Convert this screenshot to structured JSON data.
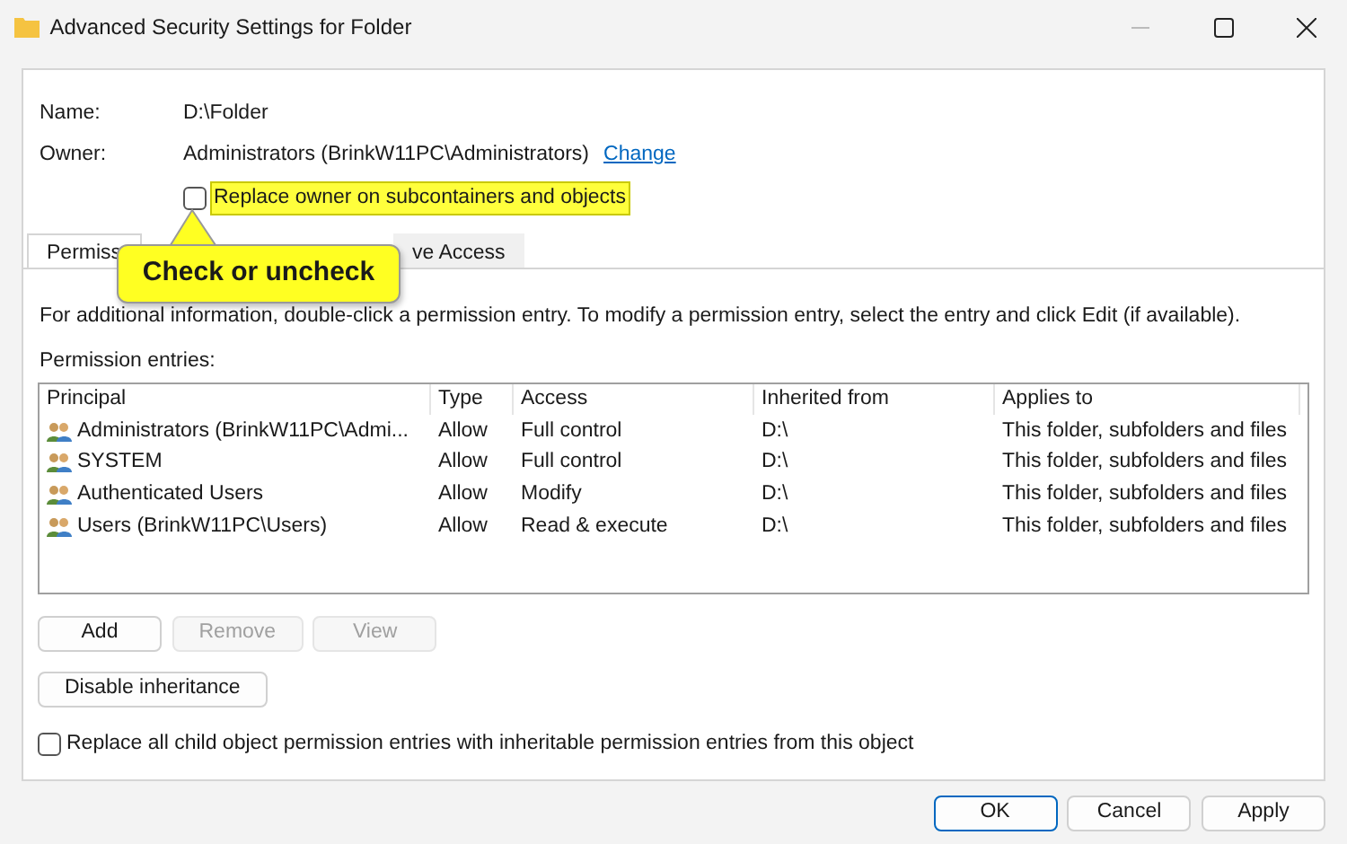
{
  "window": {
    "title": "Advanced Security Settings for Folder"
  },
  "name": {
    "label": "Name:",
    "value": "D:\\Folder"
  },
  "owner": {
    "label": "Owner:",
    "value": "Administrators (BrinkW11PC\\Administrators)",
    "link": "Change"
  },
  "owner_checkbox": {
    "label": "Replace owner on subcontainers and objects",
    "checked": false,
    "highlighted": true
  },
  "callout": {
    "text": "Check or uncheck"
  },
  "tabs": [
    {
      "label": "Permiss",
      "selected": true
    },
    {
      "label": "ve Access",
      "selected": false
    }
  ],
  "info": "For additional information, double-click a permission entry. To modify a permission entry, select the entry and click Edit (if available).",
  "entries_label": "Permission entries:",
  "table": {
    "columns": [
      "Principal",
      "Type",
      "Access",
      "Inherited from",
      "Applies to"
    ],
    "rows": [
      [
        "Administrators (BrinkW11PC\\Admi...",
        "Allow",
        "Full control",
        "D:\\",
        "This folder, subfolders and files"
      ],
      [
        "SYSTEM",
        "Allow",
        "Full control",
        "D:\\",
        "This folder, subfolders and files"
      ],
      [
        "Authenticated Users",
        "Allow",
        "Modify",
        "D:\\",
        "This folder, subfolders and files"
      ],
      [
        "Users (BrinkW11PC\\Users)",
        "Allow",
        "Read & execute",
        "D:\\",
        "This folder, subfolders and files"
      ]
    ]
  },
  "entry_buttons": [
    {
      "label": "Add",
      "disabled": false
    },
    {
      "label": "Remove",
      "disabled": true
    },
    {
      "label": "View",
      "disabled": true
    }
  ],
  "inheritance_button": "Disable inheritance",
  "replace_checkbox": {
    "label": "Replace all child object permission entries with inheritable permission entries from this object",
    "checked": false
  },
  "footer_buttons": [
    {
      "label": "OK",
      "default": true
    },
    {
      "label": "Cancel",
      "default": false
    },
    {
      "label": "Apply",
      "default": false
    }
  ]
}
